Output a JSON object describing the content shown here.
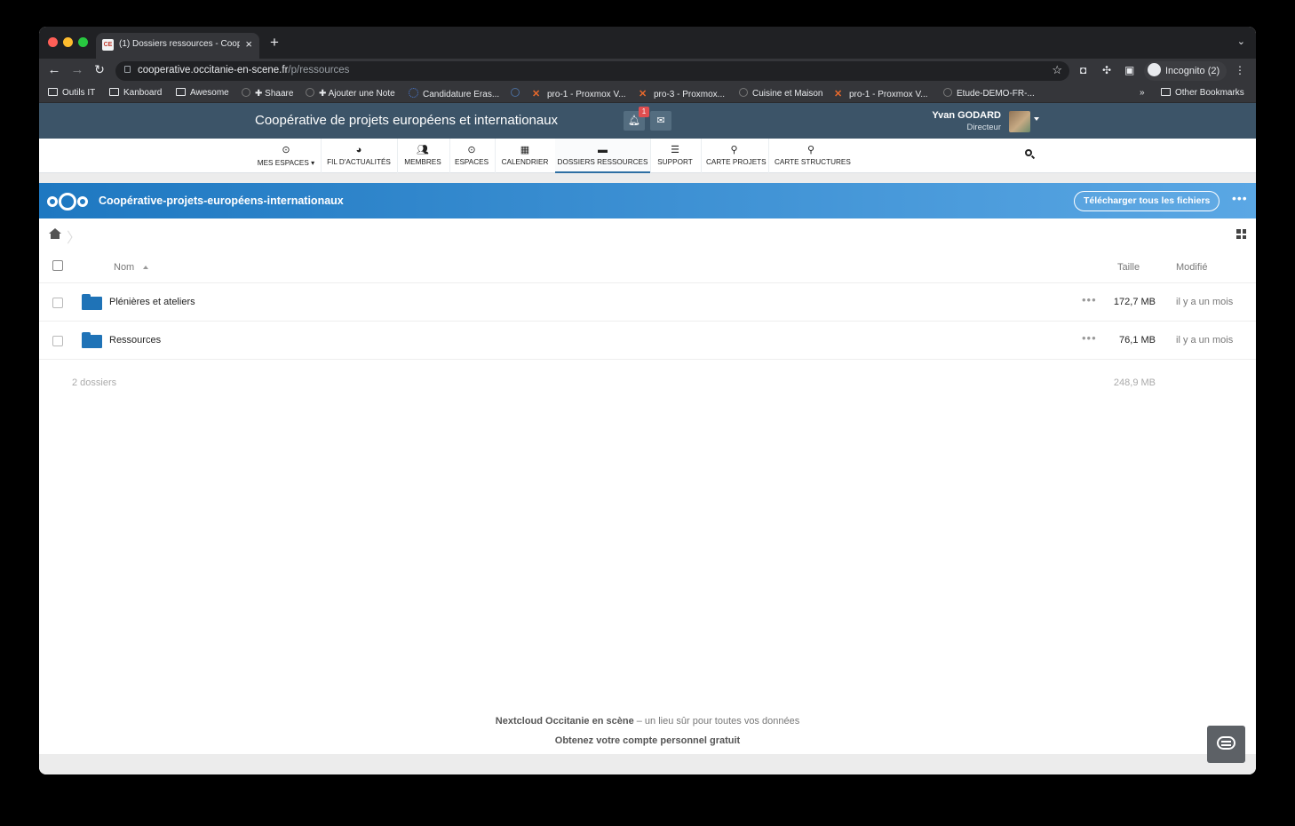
{
  "browser": {
    "tab_title": "(1) Dossiers ressources - Coop",
    "tab_favicon": "CE",
    "url_host": "cooperative.occitanie-en-scene.fr",
    "url_path": "/p/ressources",
    "incognito_label": "Incognito (2)",
    "bookmarks": [
      {
        "label": "Outils IT",
        "icon": "folder-icon"
      },
      {
        "label": "Kanboard",
        "icon": "folder-icon"
      },
      {
        "label": "Awesome",
        "icon": "folder-icon"
      },
      {
        "label": "✚ Shaare",
        "icon": "globe-icon"
      },
      {
        "label": "✚ Ajouter une Note",
        "icon": "globe-icon"
      },
      {
        "label": "Candidature Eras...",
        "icon": "eu-flag-icon"
      },
      {
        "label": "",
        "icon": "site-icon"
      },
      {
        "label": "pro-1 - Proxmox V...",
        "icon": "proxmox-icon"
      },
      {
        "label": "pro-3 - Proxmox...",
        "icon": "proxmox-icon"
      },
      {
        "label": "Cuisine et Maison",
        "icon": "globe-icon"
      },
      {
        "label": "pro-1 - Proxmox V...",
        "icon": "proxmox-icon"
      },
      {
        "label": "Etude-DEMO-FR-...",
        "icon": "globe-icon"
      }
    ],
    "bookmarks_overflow": "»",
    "other_bookmarks": "Other Bookmarks"
  },
  "site": {
    "title": "Coopérative de projets européens et internationaux",
    "notification_count": "1",
    "user_name": "Yvan GODARD",
    "user_role": "Directeur"
  },
  "nav": [
    {
      "label": "MES ESPACES ▾",
      "icon": "target-icon"
    },
    {
      "label": "FIL D'ACTUALITÉS",
      "icon": "dashboard-icon"
    },
    {
      "label": "MEMBRES",
      "icon": "users-icon"
    },
    {
      "label": "ESPACES",
      "icon": "target-icon"
    },
    {
      "label": "CALENDRIER",
      "icon": "calendar-icon"
    },
    {
      "label": "DOSSIERS RESSOURCES",
      "icon": "folder-icon",
      "active": true
    },
    {
      "label": "SUPPORT",
      "icon": "list-icon"
    },
    {
      "label": "CARTE PROJETS",
      "icon": "map-marker-icon"
    },
    {
      "label": "CARTE STRUCTURES",
      "icon": "map-marker-icon"
    }
  ],
  "nextcloud": {
    "folder_name": "Coopérative-projets-européens-internationaux",
    "download_all": "Télécharger tous les fichiers",
    "more": "•••"
  },
  "table": {
    "col_name": "Nom",
    "col_size": "Taille",
    "col_modified": "Modifié",
    "rows": [
      {
        "name": "Plénières et ateliers",
        "size": "172,7 MB",
        "modified": "il y a un mois"
      },
      {
        "name": "Ressources",
        "size": "76,1 MB",
        "modified": "il y a un mois"
      }
    ],
    "summary_count": "2 dossiers",
    "summary_size": "248,9 MB",
    "row_actions": "•••"
  },
  "footer": {
    "brand": "Nextcloud Occitanie en scène",
    "tagline": " – un lieu sûr pour toutes vos données",
    "cta": "Obtenez votre compte personnel gratuit"
  },
  "colors": {
    "site_header": "#3c5468",
    "nextcloud_blue": "#1e78c1",
    "folder": "#1f73b7",
    "active_tab_underline": "#2e6fa3"
  }
}
